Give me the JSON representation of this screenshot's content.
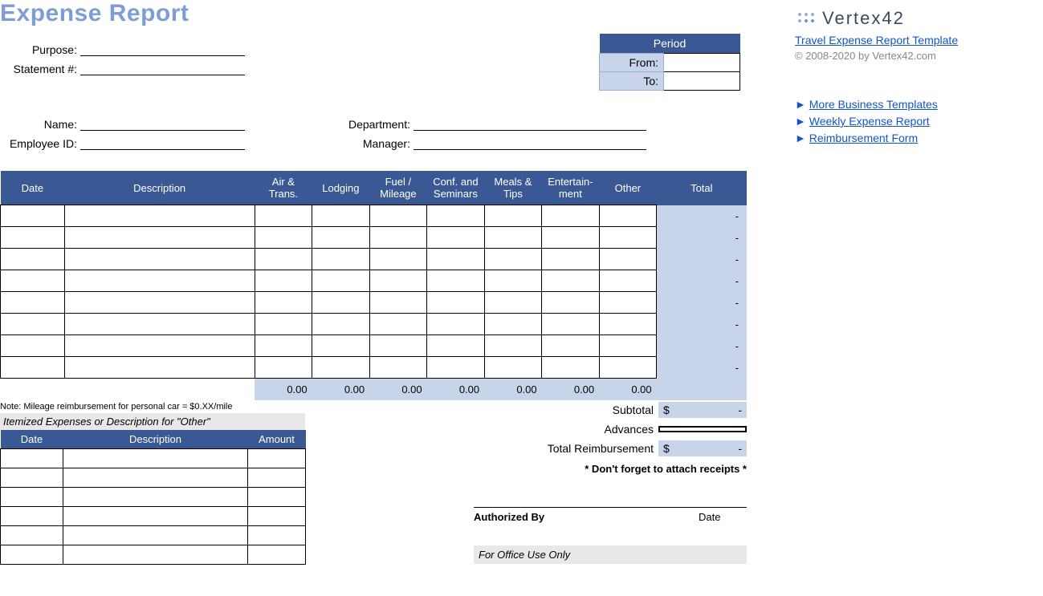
{
  "title": "Expense Report",
  "info": {
    "purpose_label": "Purpose:",
    "statement_label": "Statement #:",
    "name_label": "Name:",
    "employee_label": "Employee ID:",
    "department_label": "Department:",
    "manager_label": "Manager:"
  },
  "period": {
    "header": "Period",
    "from_label": "From:",
    "to_label": "To:",
    "from_value": "",
    "to_value": ""
  },
  "columns": {
    "date": "Date",
    "description": "Description",
    "air": "Air & Trans.",
    "lodging": "Lodging",
    "fuel": "Fuel / Mileage",
    "conf": "Conf. and Seminars",
    "meals": "Meals & Tips",
    "ent": "Entertain-ment",
    "other": "Other",
    "total": "Total"
  },
  "row_total_placeholder": "-",
  "col_totals": {
    "air": "0.00",
    "lodging": "0.00",
    "fuel": "0.00",
    "conf": "0.00",
    "meals": "0.00",
    "ent": "0.00",
    "other": "0.00"
  },
  "note": "Note: Mileage reimbursement for personal car = $0.XX/mile",
  "itemized": {
    "title": "Itemized Expenses or Description for \"Other\"",
    "cols": {
      "date": "Date",
      "description": "Description",
      "amount": "Amount"
    }
  },
  "summary": {
    "subtotal_label": "Subtotal",
    "subtotal_currency": "$",
    "subtotal_value": "-",
    "advances_label": "Advances",
    "advances_value": "",
    "total_label": "Total Reimbursement",
    "total_currency": "$",
    "total_value": "-",
    "receipt_note": "* Don't forget to attach receipts *"
  },
  "auth": {
    "by_label": "Authorized By",
    "date_label": "Date",
    "office_use": "For Office Use Only"
  },
  "side": {
    "logo_text": "Vertex42",
    "template_link": "Travel Expense Report Template",
    "copyright": "© 2008-2020 by Vertex42.com",
    "links": [
      "More Business Templates",
      "Weekly Expense Report",
      "Reimbursement Form"
    ]
  }
}
